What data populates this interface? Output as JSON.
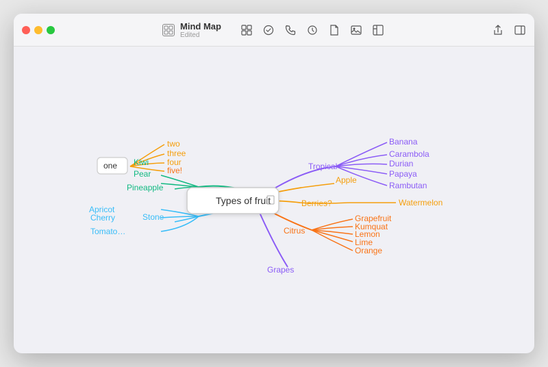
{
  "window": {
    "title": "Mind Map",
    "subtitle": "Edited"
  },
  "toolbar": {
    "left_icons": [
      "grid",
      "check-circle",
      "phone",
      "history",
      "document",
      "image",
      "layout"
    ],
    "right_icons": [
      "share",
      "sidebar"
    ]
  },
  "mindmap": {
    "central": "Types of fruit",
    "branches": {
      "tropical": {
        "label": "Tropical",
        "color": "#8b5cf6",
        "children": [
          "Banana",
          "Carambola",
          "Durian",
          "Papaya",
          "Rambutan"
        ]
      },
      "apple": {
        "label": "Apple",
        "color": "#f59e0b"
      },
      "berries": {
        "label": "Berries?",
        "color": "#f59e0b",
        "children": [
          "Watermelon"
        ]
      },
      "citrus": {
        "label": "Citrus",
        "color": "#f97316",
        "children": [
          "Grapefruit",
          "Kumquat",
          "Lemon",
          "Lime",
          "Orange"
        ]
      },
      "grapes": {
        "label": "Grapes",
        "color": "#8b5cf6"
      },
      "stone": {
        "label": "Stone",
        "color": "#38bdf8",
        "children": [
          "Apricot",
          "Cherry",
          "Tomato..."
        ]
      },
      "pineapple": {
        "label": "Pineapple",
        "color": "#10b981",
        "children": [
          "Kiwi",
          "Pear"
        ]
      },
      "one": {
        "label": "one",
        "color": "#f59e0b",
        "children": [
          "two",
          "three",
          "four",
          "five!"
        ]
      }
    }
  }
}
